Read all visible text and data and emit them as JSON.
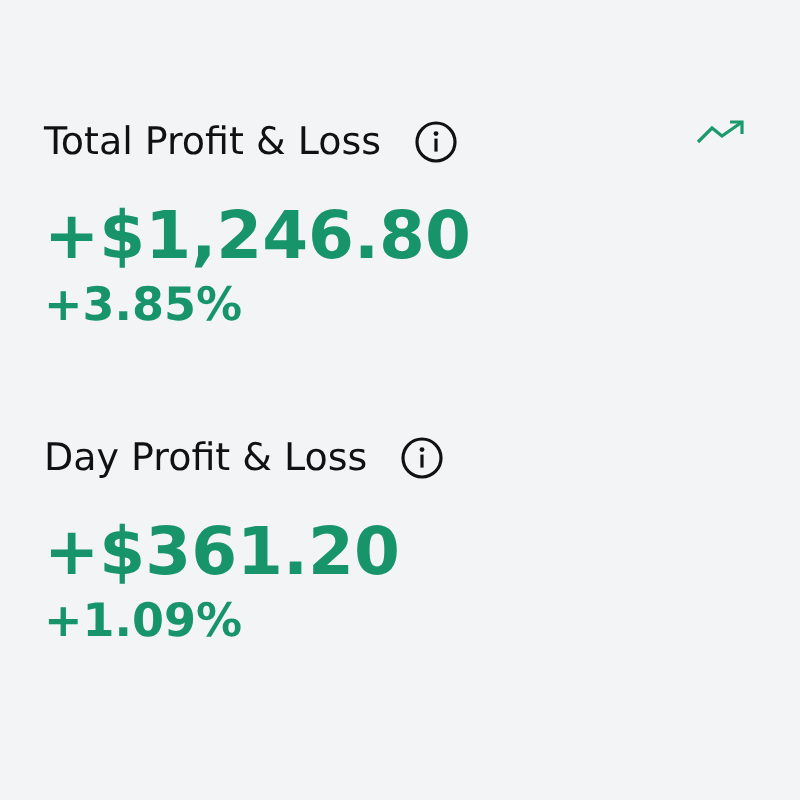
{
  "sections": [
    {
      "kind": "trend",
      "title": "Total Profit & Loss",
      "value": "+$1,246.80",
      "percent": "+3.85%"
    },
    {
      "kind": "plain",
      "title": "Day Profit & Loss",
      "value": "+$361.20",
      "percent": "+1.09%"
    }
  ]
}
